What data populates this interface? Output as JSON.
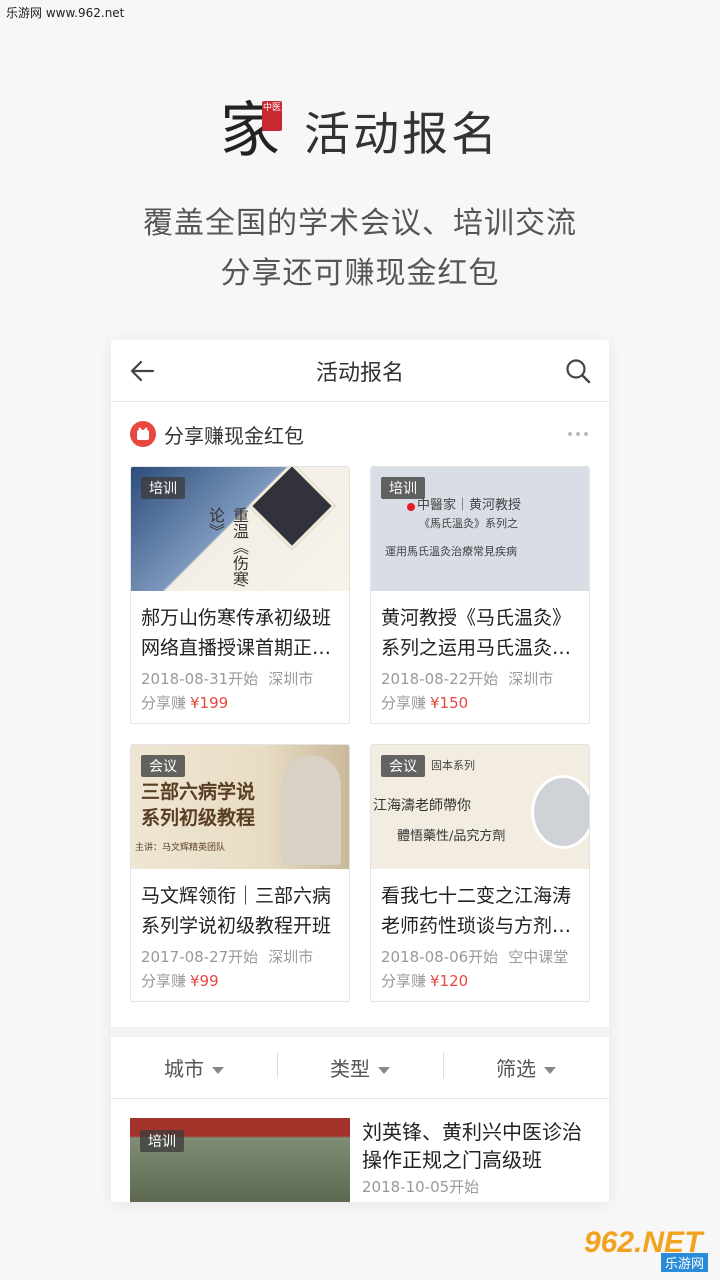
{
  "watermark_top": "乐游网 www.962.net",
  "hero": {
    "logo_char": "家",
    "logo_seal": "中医",
    "title": "活动报名",
    "subtitle_line1": "覆盖全国的学术会议、培训交流",
    "subtitle_line2": "分享还可赚现金红包"
  },
  "app": {
    "nav_title": "活动报名",
    "share_header": "分享赚现金红包",
    "cards": [
      {
        "tag": "培训",
        "title": "郝万山伤寒传承初级班网络直播授课首期正…",
        "date": "2018-08-31开始",
        "location": "深圳市",
        "earn_label": "分享赚",
        "price": "¥199",
        "img_text": "重温《伤寒论》"
      },
      {
        "tag": "培训",
        "title": "黄河教授《马氏温灸》系列之运用马氏温灸…",
        "date": "2018-08-22开始",
        "location": "深圳市",
        "earn_label": "分享赚",
        "price": "¥150",
        "img_text_1": "中醫家｜黄河教授",
        "img_text_2": "《馬氏溫灸》系列之",
        "img_text_3": "運用馬氏溫灸治療常見疾病"
      },
      {
        "tag": "会议",
        "title": "马文辉领衔｜三部六病系列学说初级教程开班",
        "date": "2017-08-27开始",
        "location": "深圳市",
        "earn_label": "分享赚",
        "price": "¥99",
        "img_text_1": "三部六病学说",
        "img_text_2": "系列初级教程",
        "img_text_3": "主讲：马文辉精英团队"
      },
      {
        "tag": "会议",
        "title": "看我七十二变之江海涛老师药性琐谈与方剂…",
        "date": "2018-08-06开始",
        "location": "空中课堂",
        "earn_label": "分享赚",
        "price": "¥120",
        "img_text_1": "固本系列",
        "img_text_2": "江海濤老師帶你",
        "img_text_3": "體悟藥性/品究方劑"
      }
    ],
    "filters": [
      "城市",
      "类型",
      "筛选"
    ],
    "list": [
      {
        "tag": "培训",
        "title": "刘英锋、黄利兴中医诊治操作正规之门高级班",
        "date": "2018-10-05开始"
      }
    ]
  },
  "watermark_bottom": {
    "big": "962.NET",
    "small": "乐游网"
  }
}
